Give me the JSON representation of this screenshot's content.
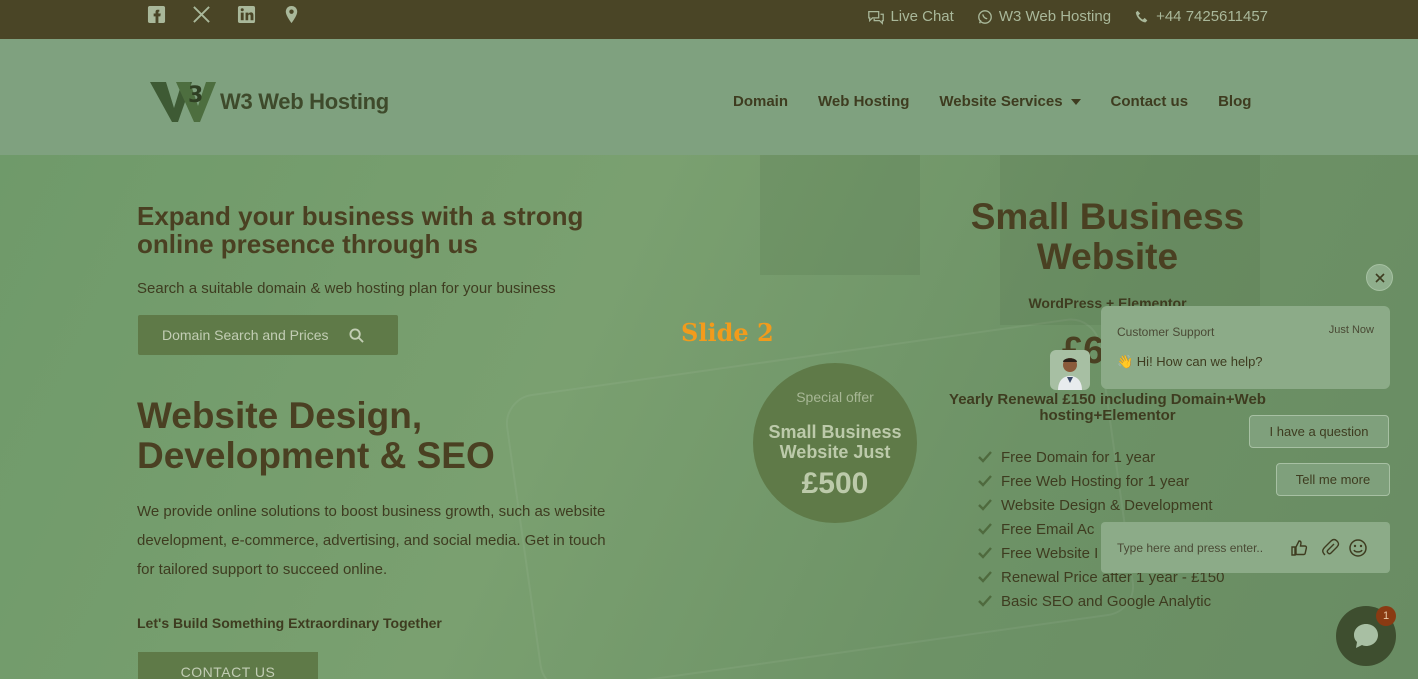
{
  "topbar": {
    "social_icons": [
      "facebook-icon",
      "x-icon",
      "linkedin-icon",
      "location-pin-icon"
    ],
    "live_chat": "Live Chat",
    "whatsapp": "W3 Web Hosting",
    "phone": "+44 7425611457"
  },
  "header": {
    "logo_text": "W3 Web Hosting",
    "nav": [
      "Domain",
      "Web Hosting",
      "Website Services",
      "Contact us",
      "Blog"
    ]
  },
  "hero": {
    "headline": "Expand your business with a strong online presence through us",
    "subtext": "Search a suitable domain & web hosting plan for your business",
    "search_button": "Domain Search and Prices",
    "big_title": "Website Design, Development & SEO",
    "description": "We provide online solutions to boost business growth, such as website development, e-commerce, advertising, and social media. Get in touch for tailored support to succeed online.",
    "tagline": "Let's Build Something Extraordinary Together",
    "contact_button": "CONTACT US",
    "slide_label": "Slide 2"
  },
  "offer": {
    "label": "Special offer",
    "title": "Small Business Website Just",
    "price": "£500"
  },
  "plan": {
    "title": "Small Business Website",
    "subtitle": "WordPress + Elementor",
    "price_partial": "£6",
    "renewal": "Yearly Renewal £150 including Domain+Web hosting+Elementor",
    "features": [
      "Free Domain for 1 year",
      "Free Web Hosting for 1 year",
      "Website Design & Development",
      "Free Email Ac",
      "Free Website I",
      "Renewal Price after 1 year - £150",
      "Basic SEO and Google Analytic"
    ]
  },
  "chat": {
    "agent": "Customer Support",
    "time": "Just Now",
    "message": "👋 Hi! How can we help?",
    "option1": "I have a question",
    "option2": "Tell me more",
    "input_placeholder": "Type here and press enter..",
    "badge": "1"
  }
}
